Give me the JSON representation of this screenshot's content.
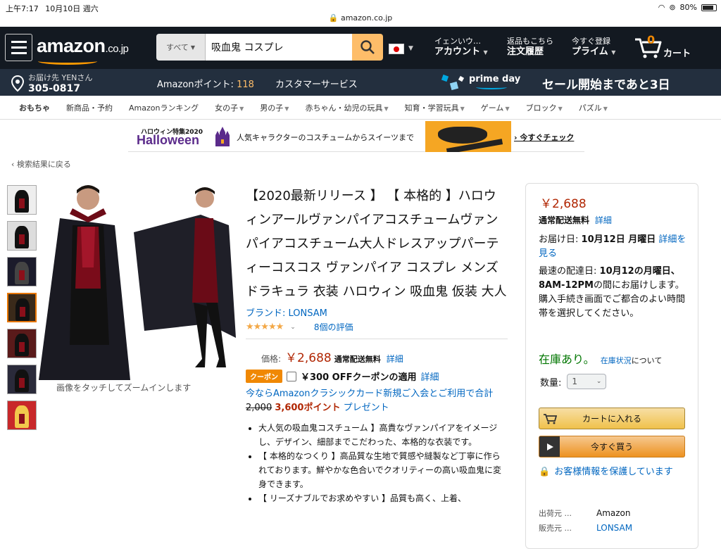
{
  "status": {
    "time": "上午7:17",
    "date": "10月10日 週六",
    "url": "amazon.co.jp",
    "battery": "80%"
  },
  "header": {
    "logo": "amazon",
    "logo_suffix": ".co.jp",
    "search_dept": "すべて",
    "search_query": "吸血鬼 コスプレ",
    "account_line1": "イェンいウ…",
    "account_line2": "アカウント",
    "orders_line1": "返品もこちら",
    "orders_line2": "注文履歴",
    "prime_line1": "今すぐ登録",
    "prime_line2": "プライム",
    "cart_count": "0",
    "cart_label": "カート"
  },
  "subnav": {
    "deliver_to": "お届け先 YENさん",
    "postal": "305-0817",
    "points_label": "Amazonポイント:",
    "points_value": "118",
    "customer_service": "カスタマーサービス",
    "prime_day": "prime day",
    "sale_text": "セール開始まであと3日"
  },
  "categories": [
    "おもちゃ",
    "新商品・予約",
    "Amazonランキング",
    "女の子",
    "男の子",
    "赤ちゃん・幼児の玩具",
    "知育・学習玩具",
    "ゲーム",
    "ブロック",
    "パズル"
  ],
  "category_dropdowns": [
    false,
    false,
    false,
    true,
    true,
    true,
    true,
    true,
    true,
    true
  ],
  "banner": {
    "top": "ハロウィン特集2020",
    "main": "Halloween",
    "text": "人気キャラクターのコスチュームからスイーツまで",
    "cta": "› 今すぐチェック"
  },
  "back_link": "‹ 検索結果に戻る",
  "zoom_hint": "画像をタッチしてズームインします",
  "product": {
    "title": "【2020最新リリース 】 【 本格的 】ハロウィンアールヴァンパイアコスチュームヴァンパイアコスチューム大人ドレスアップパーティーコスコス ヴァンパイア コスプレ メンズ ドラキュラ 衣装 ハロウィン 吸血鬼 仮装 大人",
    "brand": "ブランド: LONSAM",
    "stars": "★★★★★",
    "reviews": "8個の評価",
    "price_label": "価格:",
    "price": "￥2,688",
    "free_shipping": "通常配送無料",
    "details": "詳細",
    "coupon_badge": "クーポン",
    "coupon_text": "￥300 OFFクーポンの適用",
    "coupon_details": "詳細",
    "card_promo": "今ならAmazonクラシックカード新規ご入会とご利用で合計",
    "card_strike": "2,000",
    "card_points": "3,600ポイント",
    "card_gift": "プレゼント",
    "bullets": [
      "大人気の吸血鬼コスチューム 】高貴なヴァンパイアをイメージし、デザイン、細部までこだわった、本格的な衣装です。",
      "【 本格的なつくり 】高品質な生地で質感や縫製など丁寧に作られております。鮮やかな色合いでクオリティーの高い吸血鬼に変身できます。",
      "【 リーズナブルでお求めやすい 】品質も高く、上着、"
    ]
  },
  "buybox": {
    "price": "￥2,688",
    "free_shipping": "通常配送無料",
    "details": "詳細",
    "delivery_label": "お届け日:",
    "delivery_date": "10月12日 月曜日",
    "delivery_link": "詳細を見る",
    "fast_prefix": "最速の配達日:",
    "fast_date": "10月12の月曜日、8AM-12PM",
    "fast_suffix": "の間にお届けします。 購入手続き画面でご都合のよい時間帯を選択してください。",
    "stock": "在庫あり。",
    "stock_link": "在庫状況",
    "stock_suffix": "について",
    "qty_label": "数量:",
    "qty_value": "1",
    "add_to_cart": "カートに入れる",
    "buy_now": "今すぐ買う",
    "secure": "お客様情報を保護しています",
    "shipper_label": "出荷元 ...",
    "shipper": "Amazon",
    "seller_label": "販売元 ...",
    "seller": "LONSAM"
  }
}
